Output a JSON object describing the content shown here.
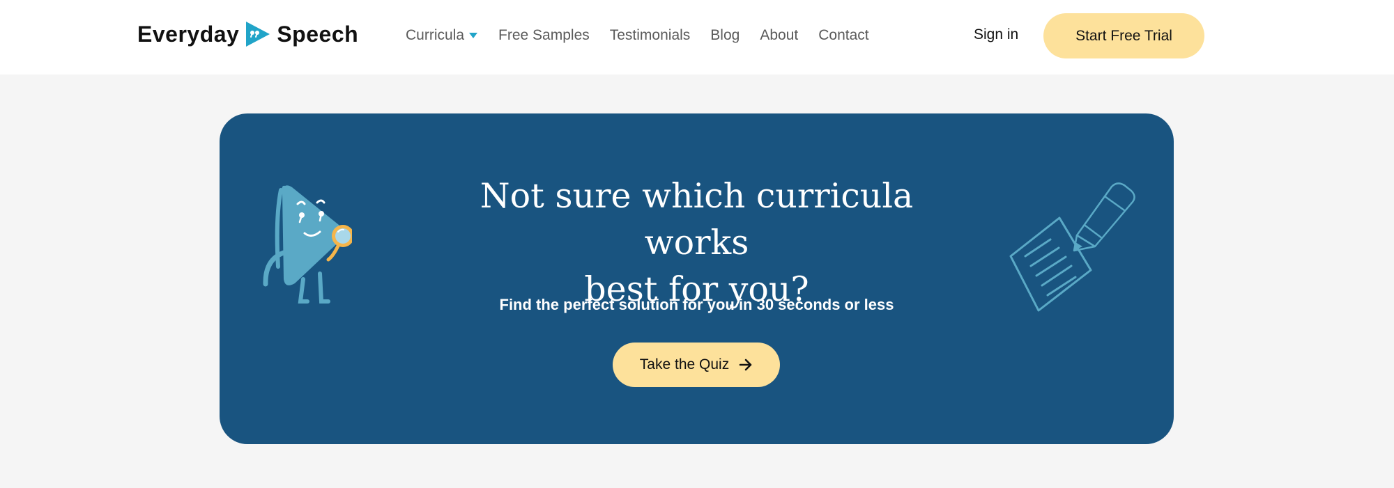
{
  "header": {
    "logo": {
      "word1": "Everyday",
      "word2": "Speech",
      "icon": "play-quote-logo-icon"
    },
    "nav": [
      {
        "label": "Curricula",
        "dropdown": true
      },
      {
        "label": "Free Samples"
      },
      {
        "label": "Testimonials"
      },
      {
        "label": "Blog"
      },
      {
        "label": "About"
      },
      {
        "label": "Contact"
      }
    ],
    "sign_in": "Sign in",
    "cta": "Start Free Trial"
  },
  "banner": {
    "title_line1": "Not sure which curricula works",
    "title_line2": "best for you?",
    "subtitle": "Find the perfect solution for you in 30 seconds or less",
    "button": "Take the Quiz",
    "button_icon": "arrow-right-icon",
    "illustrations": [
      "triangle-mascot-magnifier",
      "paper-pencil-notes"
    ]
  },
  "colors": {
    "banner_bg": "#195480",
    "accent_button": "#fde19b",
    "logo_teal": "#21a4c8",
    "page_bg": "#f5f5f5"
  }
}
